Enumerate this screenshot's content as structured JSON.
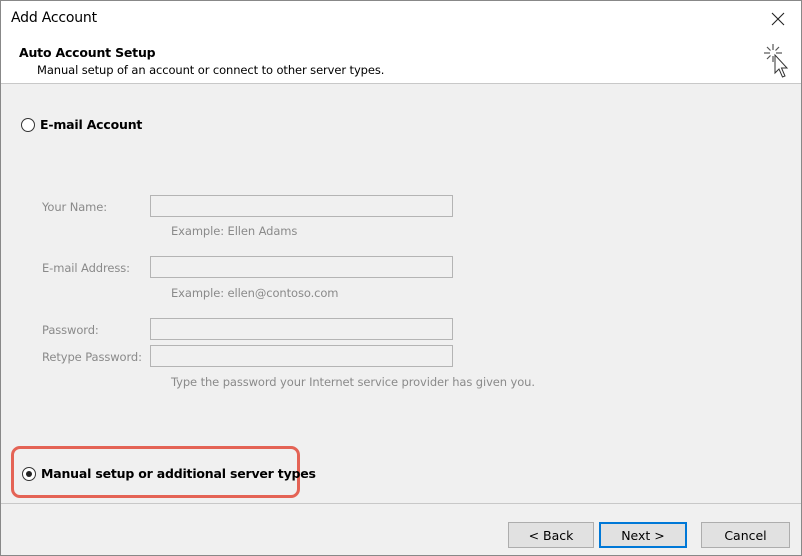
{
  "window": {
    "title": "Add Account",
    "close_icon": "close-icon"
  },
  "header": {
    "title": "Auto Account Setup",
    "subtitle": "Manual setup of an account or connect to other server types.",
    "icon": "wand-cursor-icon"
  },
  "options": {
    "email_account": {
      "label": "E-mail Account",
      "selected": false
    },
    "manual_setup": {
      "label": "Manual setup or additional server types",
      "selected": true
    }
  },
  "form": {
    "your_name": {
      "label": "Your Name:",
      "value": "",
      "hint": "Example: Ellen Adams"
    },
    "email_address": {
      "label": "E-mail Address:",
      "value": "",
      "hint": "Example: ellen@contoso.com"
    },
    "password": {
      "label": "Password:",
      "value": ""
    },
    "retype_password": {
      "label": "Retype Password:",
      "value": "",
      "hint": "Type the password your Internet service provider has given you."
    }
  },
  "buttons": {
    "back": "< Back",
    "next": "Next >",
    "cancel": "Cancel"
  },
  "colors": {
    "highlight": "#e46355",
    "default_button_border": "#0078d7",
    "disabled_text": "#8a8a8a"
  }
}
